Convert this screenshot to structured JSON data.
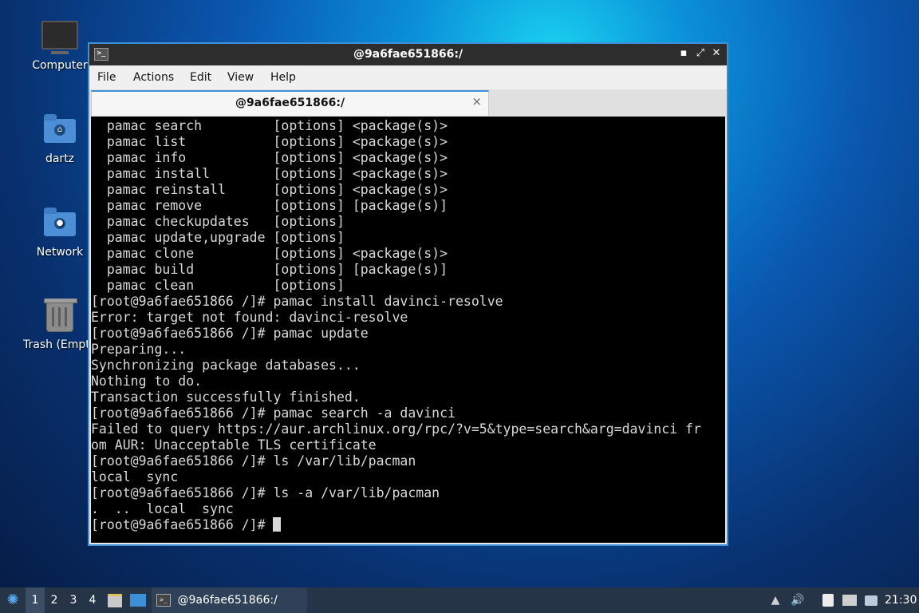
{
  "desktop": {
    "icons": [
      {
        "label": "Computer",
        "icon": "monitor-icon"
      },
      {
        "label": "dartz",
        "icon": "home-folder-icon"
      },
      {
        "label": "Network",
        "icon": "network-folder-icon"
      },
      {
        "label": "Trash (Empty)",
        "icon": "trash-icon"
      }
    ]
  },
  "window": {
    "title": "@9a6fae651866:/",
    "menu": [
      "File",
      "Actions",
      "Edit",
      "View",
      "Help"
    ],
    "tab_label": "@9a6fae651866:/",
    "tab_close": "×",
    "buttons": {
      "minimize": "▪",
      "maximize": "⤢",
      "close": "✕"
    }
  },
  "terminal": {
    "lines": [
      "  pamac search         [options] <package(s)>",
      "  pamac list           [options] <package(s)>",
      "  pamac info           [options] <package(s)>",
      "  pamac install        [options] <package(s)>",
      "  pamac reinstall      [options] <package(s)>",
      "  pamac remove         [options] [package(s)]",
      "  pamac checkupdates   [options]",
      "  pamac update,upgrade [options]",
      "  pamac clone          [options] <package(s)>",
      "  pamac build          [options] [package(s)]",
      "  pamac clean          [options]",
      "[root@9a6fae651866 /]# pamac install davinci-resolve",
      "Error: target not found: davinci-resolve",
      "[root@9a6fae651866 /]# pamac update",
      "Preparing...",
      "Synchronizing package databases...",
      "Nothing to do.",
      "Transaction successfully finished.",
      "[root@9a6fae651866 /]# pamac search -a davinci",
      "Failed to query https://aur.archlinux.org/rpc/?v=5&type=search&arg=davinci fr",
      "om AUR: Unacceptable TLS certificate",
      "[root@9a6fae651866 /]# ls /var/lib/pacman",
      "local  sync",
      "[root@9a6fae651866 /]# ls -a /var/lib/pacman",
      ".  ..  local  sync"
    ],
    "prompt": "[root@9a6fae651866 /]# "
  },
  "taskbar": {
    "workspaces": [
      "1",
      "2",
      "3",
      "4"
    ],
    "active_workspace": "1",
    "task_label": "@9a6fae651866:/",
    "clock": "21:30"
  }
}
